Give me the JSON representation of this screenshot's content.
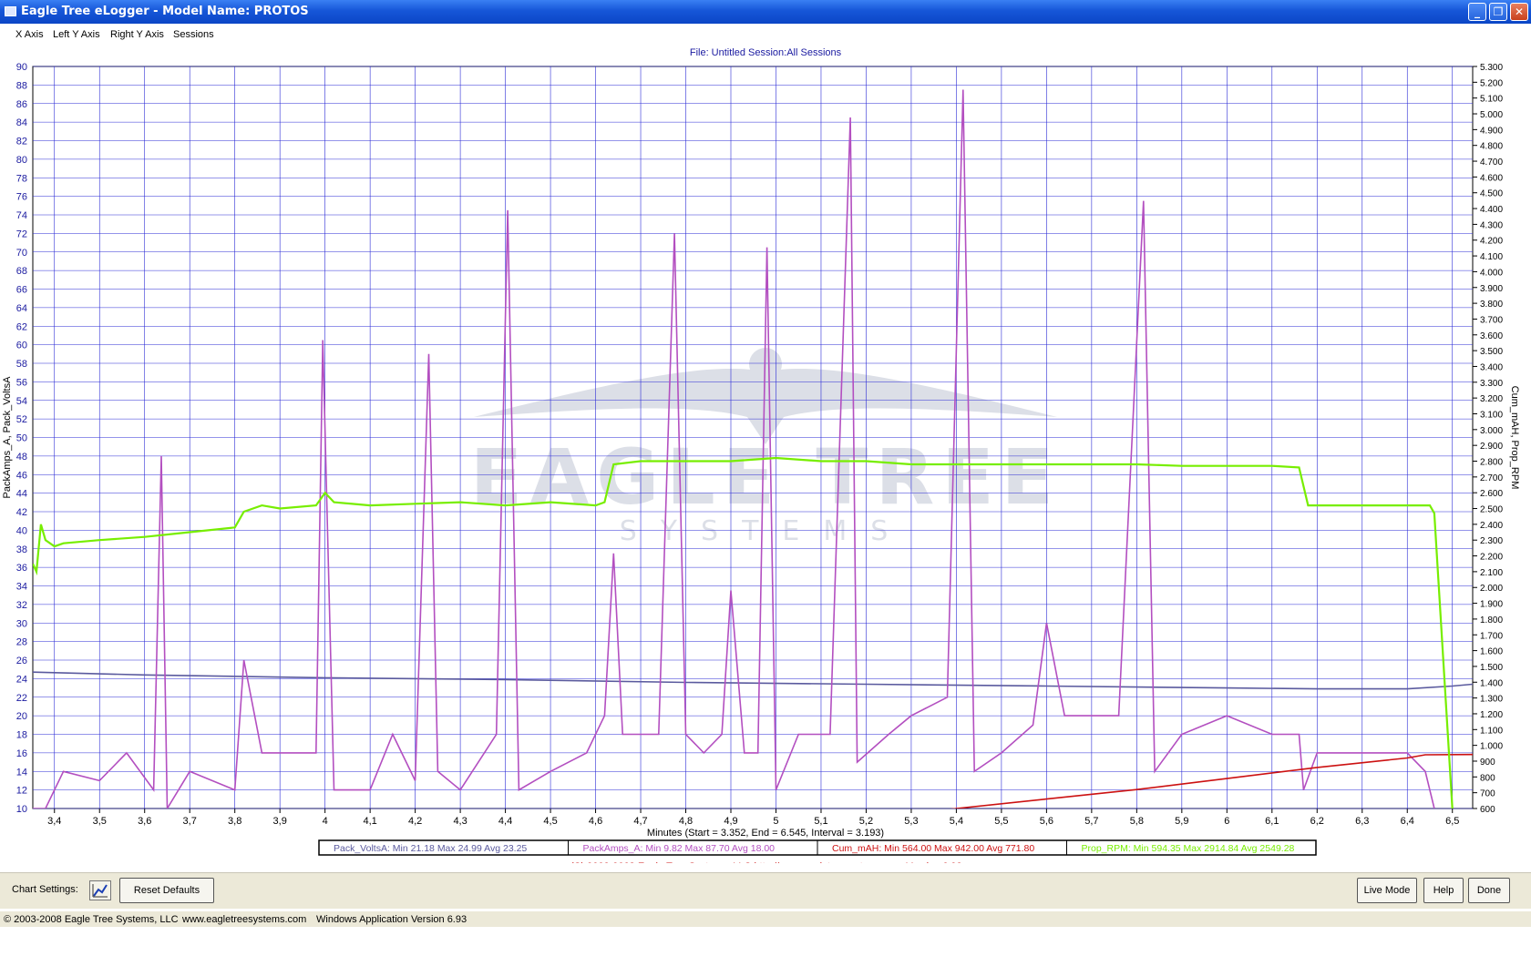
{
  "window": {
    "title": "Eagle Tree eLogger - Model Name: PROTOS"
  },
  "menu": [
    "X Axis",
    "Left Y Axis",
    "Right Y Axis",
    "Sessions"
  ],
  "file_info": "File: Untitled   Session:All Sessions",
  "copyright_line": "(C) 2003-2008 Eagle Tree Systems, LLC      http://www.eagletreesystems.com      Version 6.93",
  "footer": {
    "chart_settings_label": "Chart Settings:",
    "reset_label": "Reset Defaults",
    "live_mode_label": "Live Mode",
    "help_label": "Help",
    "done_label": "Done"
  },
  "status": {
    "copyright": "© 2003-2008 Eagle Tree Systems, LLC",
    "site": "www.eagletreesystems.com",
    "version": "Windows Application Version 6.93"
  },
  "watermark": {
    "line1": "EAGLE TREE",
    "line2": "SYSTEMS"
  },
  "colors": {
    "grid": "#2b2bd6",
    "volts": "#5a5a9e",
    "amps": "#b34fc0",
    "mah": "#cc1111",
    "rpm": "#77ee00",
    "axis_text": "#1a1aa0"
  },
  "chart_data": {
    "type": "line",
    "xlabel": "Minutes (Start = 3.352,  End = 6.545, Interval =  3.193)",
    "ylabel_left": "PackAmps_A, Pack_VoltsA",
    "ylabel_right": "Cum_mAH, Prop_RPM",
    "xlim": [
      3.352,
      6.545
    ],
    "ylim_left": [
      10,
      90
    ],
    "ylim_right": [
      600,
      5300
    ],
    "grid": true,
    "x_ticks": [
      "3,4",
      "3,5",
      "3,6",
      "3,7",
      "3,8",
      "3,9",
      "4",
      "4,1",
      "4,2",
      "4,3",
      "4,4",
      "4,5",
      "4,6",
      "4,7",
      "4,8",
      "4,9",
      "5",
      "5,1",
      "5,2",
      "5,3",
      "5,4",
      "5,5",
      "5,6",
      "5,7",
      "5,8",
      "5,9",
      "6",
      "6,1",
      "6,2",
      "6,3",
      "6,4",
      "6,5"
    ],
    "y_left_ticks": [
      "10",
      "12",
      "14",
      "16",
      "18",
      "20",
      "22",
      "24",
      "26",
      "28",
      "30",
      "32",
      "34",
      "36",
      "38",
      "40",
      "42",
      "44",
      "46",
      "48",
      "50",
      "52",
      "54",
      "56",
      "58",
      "60",
      "62",
      "64",
      "66",
      "68",
      "70",
      "72",
      "74",
      "76",
      "78",
      "80",
      "82",
      "84",
      "86",
      "88",
      "90"
    ],
    "y_right_ticks": [
      "600",
      "700",
      "800",
      "900",
      "1.000",
      "1.100",
      "1.200",
      "1.300",
      "1.400",
      "1.500",
      "1.600",
      "1.700",
      "1.800",
      "1.900",
      "2.000",
      "2.100",
      "2.200",
      "2.300",
      "2.400",
      "2.500",
      "2.600",
      "2.700",
      "2.800",
      "2.900",
      "3.000",
      "3.100",
      "3.200",
      "3.300",
      "3.400",
      "3.500",
      "3.600",
      "3.700",
      "3.800",
      "3.900",
      "4.000",
      "4.100",
      "4.200",
      "4.300",
      "4.400",
      "4.500",
      "4.600",
      "4.700",
      "4.800",
      "4.900",
      "5.000",
      "5.100",
      "5.200",
      "5.300"
    ],
    "legend": [
      {
        "name": "Pack_VoltsA",
        "stats": "Min 21.18   Max 24.99   Avg 23.25"
      },
      {
        "name": "PackAmps_A",
        "stats": "Min 9.82   Max 87.70   Avg 18.00"
      },
      {
        "name": "Cum_mAH",
        "stats": "Min 564.00   Max 942.00   Avg 771.80"
      },
      {
        "name": "Prop_RPM",
        "stats": "Min 594.35   Max 2914.84   Avg 2549.28"
      }
    ],
    "series": [
      {
        "name": "Pack_VoltsA",
        "axis": "left",
        "points": [
          [
            3.352,
            24.7
          ],
          [
            3.6,
            24.4
          ],
          [
            4.0,
            24.1
          ],
          [
            4.4,
            23.9
          ],
          [
            4.8,
            23.6
          ],
          [
            5.2,
            23.4
          ],
          [
            5.6,
            23.2
          ],
          [
            6.0,
            23.0
          ],
          [
            6.2,
            22.9
          ],
          [
            6.4,
            22.9
          ],
          [
            6.5,
            23.2
          ],
          [
            6.545,
            23.4
          ]
        ]
      },
      {
        "name": "PackAmps_A",
        "axis": "left",
        "points": [
          [
            3.352,
            10
          ],
          [
            3.38,
            10
          ],
          [
            3.42,
            14
          ],
          [
            3.5,
            13
          ],
          [
            3.56,
            16
          ],
          [
            3.62,
            12
          ],
          [
            3.637,
            48
          ],
          [
            3.65,
            10
          ],
          [
            3.7,
            14
          ],
          [
            3.8,
            12
          ],
          [
            3.82,
            26
          ],
          [
            3.86,
            16
          ],
          [
            3.94,
            16
          ],
          [
            3.98,
            16
          ],
          [
            3.995,
            60.5
          ],
          [
            4.02,
            12
          ],
          [
            4.1,
            12
          ],
          [
            4.15,
            18
          ],
          [
            4.2,
            13
          ],
          [
            4.23,
            59
          ],
          [
            4.25,
            14
          ],
          [
            4.3,
            12
          ],
          [
            4.38,
            18
          ],
          [
            4.405,
            74.5
          ],
          [
            4.43,
            12
          ],
          [
            4.5,
            14
          ],
          [
            4.58,
            16
          ],
          [
            4.62,
            20
          ],
          [
            4.64,
            37.5
          ],
          [
            4.66,
            18
          ],
          [
            4.74,
            18
          ],
          [
            4.775,
            72
          ],
          [
            4.8,
            18
          ],
          [
            4.84,
            16
          ],
          [
            4.88,
            18
          ],
          [
            4.9,
            33.5
          ],
          [
            4.93,
            16
          ],
          [
            4.96,
            16
          ],
          [
            4.98,
            70.5
          ],
          [
            5.0,
            12
          ],
          [
            5.05,
            18
          ],
          [
            5.12,
            18
          ],
          [
            5.165,
            84.5
          ],
          [
            5.18,
            15
          ],
          [
            5.25,
            18
          ],
          [
            5.3,
            20
          ],
          [
            5.38,
            22
          ],
          [
            5.415,
            87.5
          ],
          [
            5.44,
            14
          ],
          [
            5.5,
            16
          ],
          [
            5.57,
            19
          ],
          [
            5.6,
            30
          ],
          [
            5.64,
            20
          ],
          [
            5.7,
            20
          ],
          [
            5.76,
            20
          ],
          [
            5.815,
            75.5
          ],
          [
            5.84,
            14
          ],
          [
            5.9,
            18
          ],
          [
            6.0,
            20
          ],
          [
            6.1,
            18
          ],
          [
            6.16,
            18
          ],
          [
            6.17,
            12
          ],
          [
            6.2,
            16
          ],
          [
            6.3,
            16
          ],
          [
            6.4,
            16
          ],
          [
            6.44,
            14
          ],
          [
            6.46,
            10
          ]
        ]
      },
      {
        "name": "Cum_mAH",
        "axis": "right",
        "points": [
          [
            5.3,
            564
          ],
          [
            5.4,
            600
          ],
          [
            5.6,
            660
          ],
          [
            5.8,
            720
          ],
          [
            6.0,
            790
          ],
          [
            6.2,
            860
          ],
          [
            6.4,
            920
          ],
          [
            6.44,
            940
          ],
          [
            6.545,
            942
          ]
        ]
      },
      {
        "name": "Prop_RPM",
        "axis": "right",
        "points": [
          [
            3.352,
            2150
          ],
          [
            3.36,
            2100
          ],
          [
            3.37,
            2400
          ],
          [
            3.38,
            2300
          ],
          [
            3.4,
            2260
          ],
          [
            3.42,
            2280
          ],
          [
            3.5,
            2300
          ],
          [
            3.6,
            2320
          ],
          [
            3.7,
            2350
          ],
          [
            3.8,
            2380
          ],
          [
            3.82,
            2480
          ],
          [
            3.86,
            2520
          ],
          [
            3.9,
            2500
          ],
          [
            3.98,
            2520
          ],
          [
            4.0,
            2600
          ],
          [
            4.02,
            2540
          ],
          [
            4.1,
            2520
          ],
          [
            4.2,
            2530
          ],
          [
            4.3,
            2540
          ],
          [
            4.4,
            2520
          ],
          [
            4.5,
            2540
          ],
          [
            4.6,
            2520
          ],
          [
            4.62,
            2540
          ],
          [
            4.64,
            2780
          ],
          [
            4.7,
            2800
          ],
          [
            4.8,
            2800
          ],
          [
            4.9,
            2800
          ],
          [
            5.0,
            2820
          ],
          [
            5.1,
            2800
          ],
          [
            5.2,
            2800
          ],
          [
            5.3,
            2780
          ],
          [
            5.4,
            2780
          ],
          [
            5.5,
            2780
          ],
          [
            5.6,
            2780
          ],
          [
            5.7,
            2780
          ],
          [
            5.8,
            2780
          ],
          [
            5.9,
            2770
          ],
          [
            6.0,
            2770
          ],
          [
            6.1,
            2770
          ],
          [
            6.16,
            2760
          ],
          [
            6.18,
            2520
          ],
          [
            6.2,
            2520
          ],
          [
            6.3,
            2520
          ],
          [
            6.4,
            2520
          ],
          [
            6.45,
            2520
          ],
          [
            6.46,
            2470
          ],
          [
            6.5,
            600
          ]
        ]
      }
    ]
  }
}
